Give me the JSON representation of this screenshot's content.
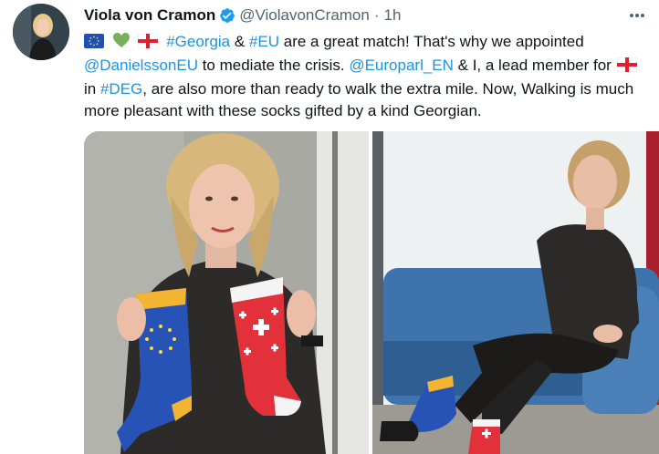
{
  "author": {
    "name": "Viola von Cramon",
    "handle": "@ViolavonCramon",
    "separator": "·",
    "time": "1h"
  },
  "tweet": {
    "t_after_hearts": "#Georgia",
    "t_amp1": " & ",
    "t_eu": "#EU",
    "t_part1": " are a great match! That's why we appointed ",
    "t_mention1": "@DanielssonEU",
    "t_part2": " to mediate the crisis. ",
    "t_mention2": "@Europarl_EN",
    "t_part3": " & I, a lead member for ",
    "t_part4": " in ",
    "t_deg": "#DEG",
    "t_part5": ", are also more than ready to walk the extra mile. Now, Walking is much more pleasant with these socks gifted by a kind Georgian."
  },
  "icons": {
    "eu_flag": "eu-flag-icon",
    "green_heart": "green-heart-icon",
    "georgia_flag": "georgia-flag-icon",
    "verified": "verified-badge-icon",
    "more": "more-options-icon"
  },
  "colors": {
    "link": "#1b95e0",
    "verified": "#1d9bf0",
    "text": "#0f1419",
    "secondary": "#536471"
  }
}
